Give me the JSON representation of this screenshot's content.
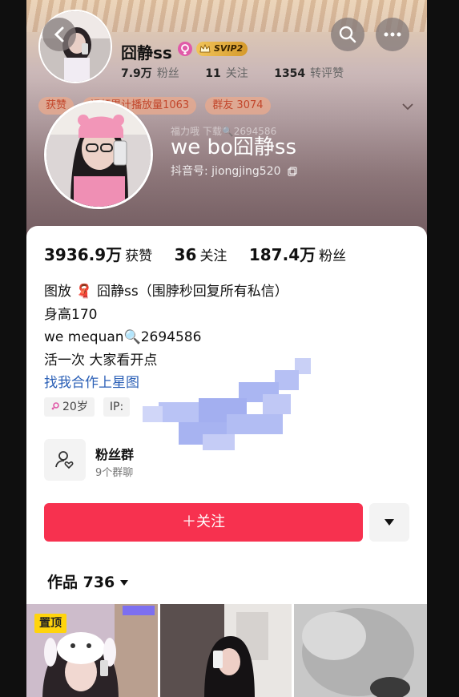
{
  "header": {
    "name": "囧静ss",
    "vip_badge": "SVIP2",
    "fans_count": "7.9万",
    "fans_label": "粉丝",
    "following_count": "11",
    "following_label": "关注",
    "repost_count": "1354",
    "repost_label": "转评赞"
  },
  "tags": [
    "获赞",
    "视频累计播放量1063",
    "群友 3074"
  ],
  "profile": {
    "display_name": "we bo囧静ss",
    "douyin_id": "抖音号: jiongjing520",
    "obscured_hint": "福力哦 下载🔍2694586"
  },
  "stats": {
    "likes_value": "3936.9万",
    "likes_label": "获赞",
    "following_value": "36",
    "following_label": "关注",
    "fans_value": "187.4万",
    "fans_label": "粉丝"
  },
  "bio": {
    "line1": "图放 🧣  囧静ss（围脖秒回复所有私信）",
    "line2": "身高170",
    "line3": "we mequan🔍2694586",
    "line4": "活一次  大家看开点",
    "link": "找我合作上星图"
  },
  "meta": {
    "age": "20岁",
    "ip": "IP:"
  },
  "fans_group": {
    "title": "粉丝群",
    "subtitle": "9个群聊"
  },
  "actions": {
    "follow_label": "＋关注"
  },
  "works": {
    "label": "作品 736"
  },
  "thumbs": {
    "pinned_label": "置顶"
  },
  "colors": {
    "accent": "#f7314f",
    "link": "#2a5fb6",
    "pin": "#ffd40d"
  }
}
